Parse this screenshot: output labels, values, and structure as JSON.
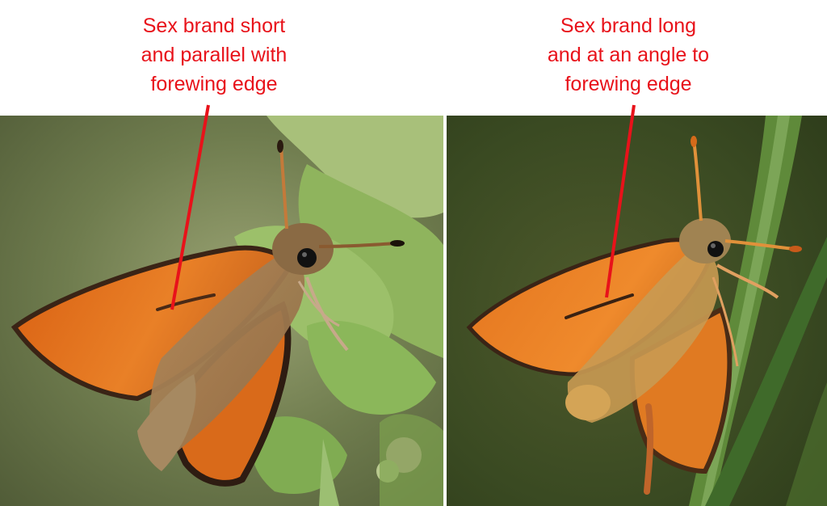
{
  "panels": [
    {
      "caption_lines": [
        "Sex brand short",
        "and parallel with",
        "forewing edge"
      ],
      "subject": "butterfly-on-leaves"
    },
    {
      "caption_lines": [
        "Sex brand long",
        "and at an angle to",
        "forewing edge"
      ],
      "subject": "butterfly-on-grass"
    }
  ],
  "colors": {
    "caption_text": "#e8121a",
    "leader_line": "#e8121a",
    "wing_orange": "#e2731e",
    "wing_border": "#3a2416",
    "background": "#ffffff"
  }
}
